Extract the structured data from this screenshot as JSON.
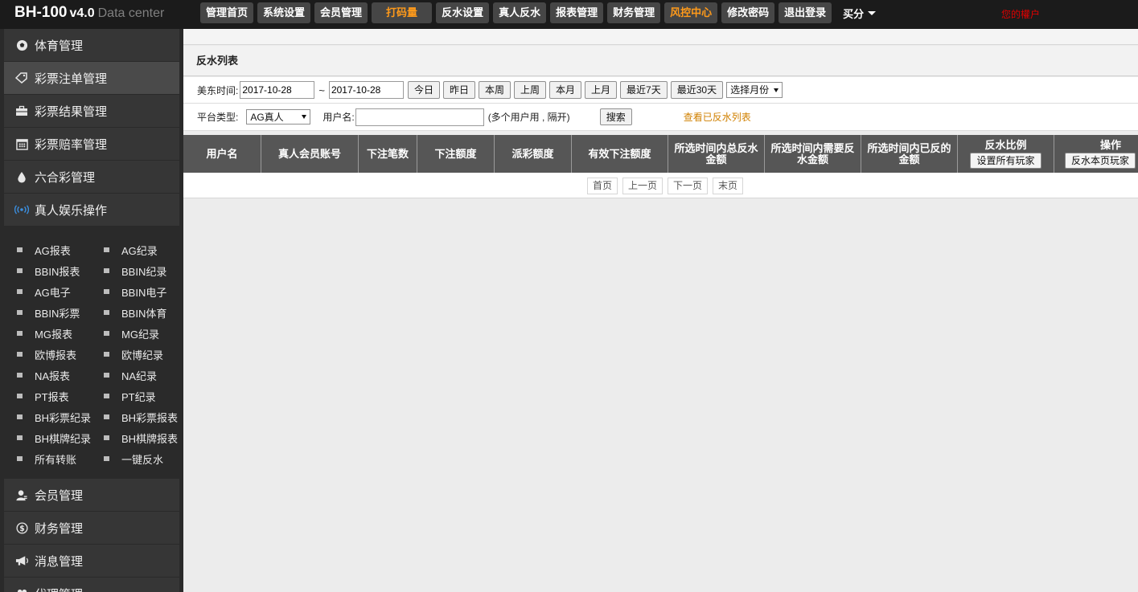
{
  "header": {
    "brand_name": "BH-100",
    "brand_version": "v4.0",
    "brand_subtitle": "Data center",
    "nav": [
      {
        "label": "管理首页"
      },
      {
        "label": "系统设置"
      },
      {
        "label": "会员管理"
      },
      {
        "label": "打码量"
      },
      {
        "label": "反水设置"
      },
      {
        "label": "真人反水"
      },
      {
        "label": "报表管理"
      },
      {
        "label": "财务管理"
      },
      {
        "label": "风控中心"
      },
      {
        "label": "修改密码"
      },
      {
        "label": "退出登录"
      }
    ],
    "dropdown_label": "买分",
    "alert_text": "您的權户",
    "highlight_color": "#ff9a1a",
    "alert_color": "#e00000"
  },
  "sidebar": {
    "items_top": [
      {
        "label": "体育管理",
        "icon": "soccer-ball-icon"
      },
      {
        "label": "彩票注单管理",
        "icon": "tag-icon"
      },
      {
        "label": "彩票结果管理",
        "icon": "briefcase-icon"
      },
      {
        "label": "彩票赔率管理",
        "icon": "calendar-icon"
      },
      {
        "label": "六合彩管理",
        "icon": "drop-icon"
      },
      {
        "label": "真人娱乐操作",
        "icon": "broadcast-icon"
      }
    ],
    "submenu": [
      "AG报表",
      "AG纪录",
      "BBIN报表",
      "BBIN纪录",
      "AG电子",
      "BBIN电子",
      "BBIN彩票",
      "BBIN体育",
      "MG报表",
      "MG纪录",
      "欧博报表",
      "欧博纪录",
      "NA报表",
      "NA纪录",
      "PT报表",
      "PT纪录",
      "BH彩票纪录",
      "BH彩票报表",
      "BH棋牌纪录",
      "BH棋牌报表",
      "所有转账",
      "一键反水"
    ],
    "items_bottom": [
      {
        "label": "会员管理",
        "icon": "user-icon"
      },
      {
        "label": "财务管理",
        "icon": "dollar-icon"
      },
      {
        "label": "消息管理",
        "icon": "megaphone-icon"
      },
      {
        "label": "代理管理",
        "icon": "users-icon"
      }
    ]
  },
  "main": {
    "panel_title": "反水列表",
    "filters": {
      "time_label": "美东时间:",
      "start_date": "2017-10-28",
      "tilde": "~",
      "end_date": "2017-10-28",
      "quick_buttons": [
        "今日",
        "昨日",
        "本周",
        "上周",
        "本月",
        "上月",
        "最近7天",
        "最近30天"
      ],
      "month_select": "选择月份",
      "platform_label": "平台类型:",
      "platform_value": "AG真人",
      "username_label": "用户名:",
      "username_value": "",
      "username_hint": "(多个用户用 , 隔开)",
      "search_label": "搜索",
      "view_link": "查看已反水列表",
      "link_color": "#d08000"
    },
    "table": {
      "columns": [
        "用户名",
        "真人会员账号",
        "下注笔数",
        "下注额度",
        "派彩额度",
        "有效下注额度",
        "所选时间内总反水金额",
        "所选时间内需要反水金额",
        "所选时间内已反的金额"
      ],
      "ratio_col": {
        "label": "反水比例",
        "button": "设置所有玩家"
      },
      "action_col": {
        "label": "操作",
        "button": "反水本页玩家"
      },
      "header_color": "#565656"
    },
    "pager": [
      "首页",
      "上一页",
      "下一页",
      "末页"
    ]
  }
}
